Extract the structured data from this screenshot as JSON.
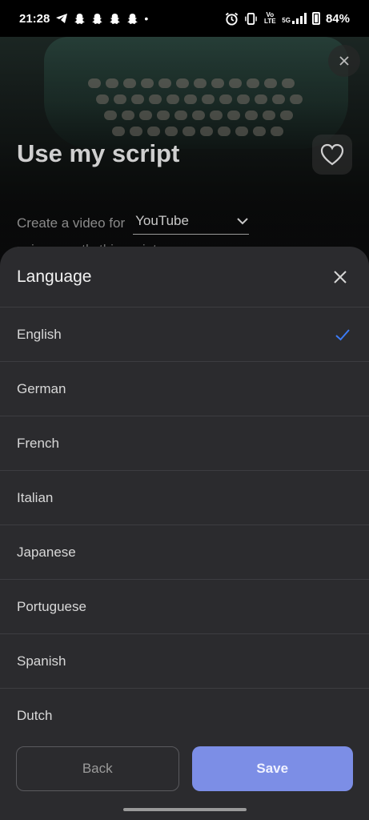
{
  "status_bar": {
    "time": "21:28",
    "battery": "84%",
    "left_icons": [
      "telegram-icon",
      "snapchat-icon",
      "snapchat-icon",
      "snapchat-icon",
      "snapchat-icon",
      "dot-icon"
    ],
    "right_icons": [
      "alarm-icon",
      "vibrate-icon",
      "volte-icon",
      "5g-signal-icon",
      "battery-icon"
    ],
    "volte_label": "Vo LTE",
    "network_label": "5G"
  },
  "background_page": {
    "title": "Use my script",
    "create_label": "Create a video for",
    "platform_value": "YouTube",
    "subtitle_partial": "using exactly this script"
  },
  "sheet": {
    "title": "Language",
    "selected": "English",
    "languages": [
      "English",
      "German",
      "French",
      "Italian",
      "Japanese",
      "Portuguese",
      "Spanish",
      "Dutch"
    ],
    "back_label": "Back",
    "save_label": "Save"
  },
  "colors": {
    "accent": "#7c8ee6",
    "check": "#3b7bf6",
    "sheet_bg": "#2b2b2e"
  }
}
